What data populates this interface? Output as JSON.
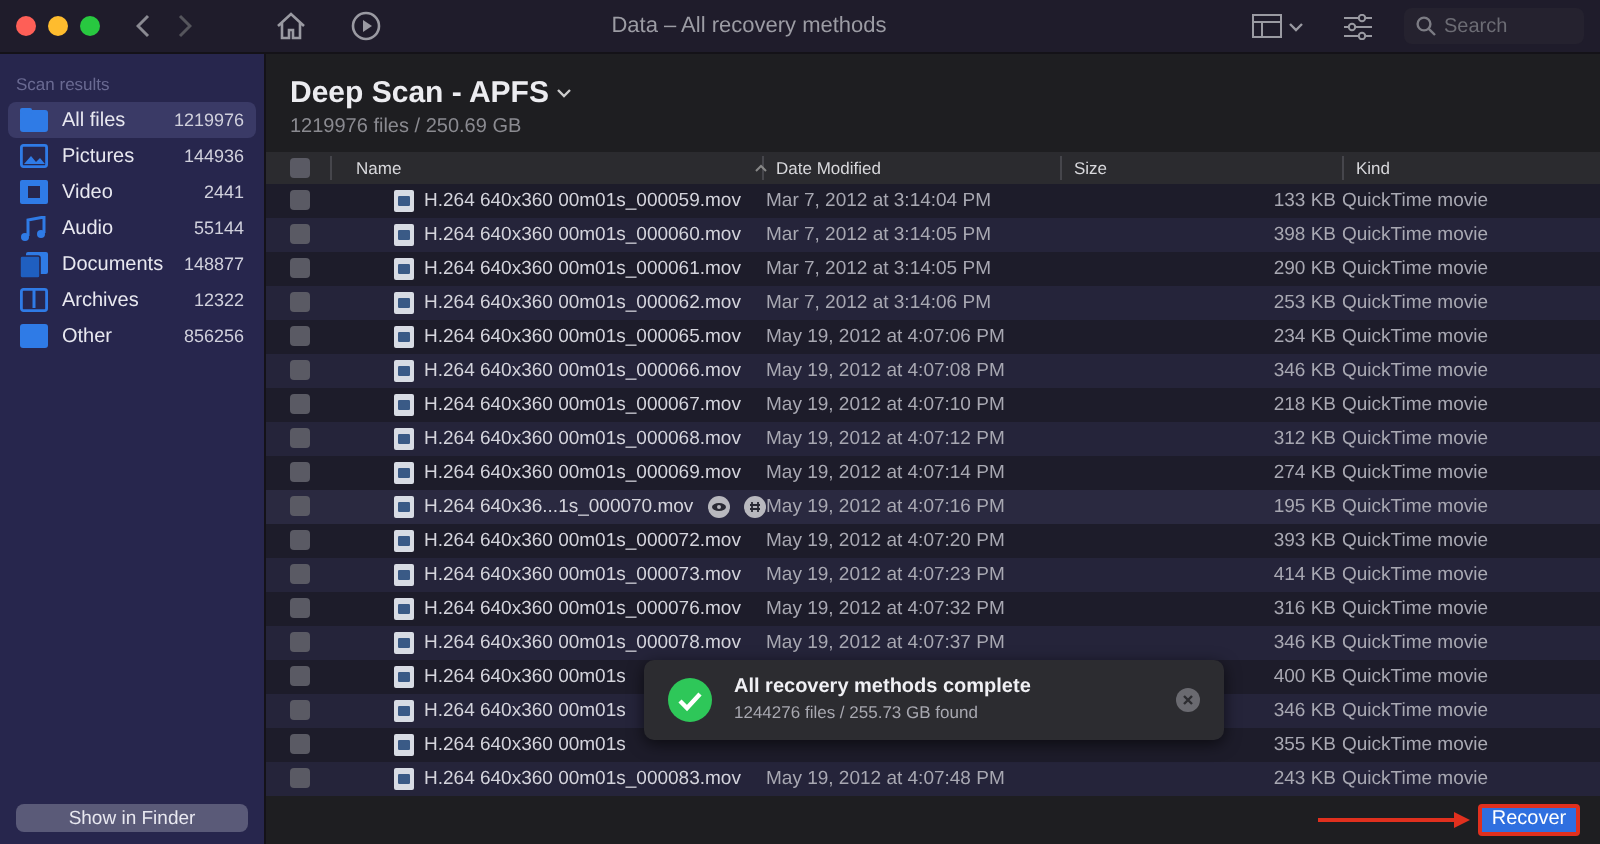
{
  "window": {
    "title": "Data – All recovery methods"
  },
  "toolbar": {
    "search": {
      "placeholder": "Search"
    }
  },
  "sidebar": {
    "heading": "Scan results",
    "items": [
      {
        "label": "All files",
        "count": "1219976",
        "selected": true,
        "kind": "all"
      },
      {
        "label": "Pictures",
        "count": "144936",
        "selected": false,
        "kind": "pictures"
      },
      {
        "label": "Video",
        "count": "2441",
        "selected": false,
        "kind": "video"
      },
      {
        "label": "Audio",
        "count": "55144",
        "selected": false,
        "kind": "audio"
      },
      {
        "label": "Documents",
        "count": "148877",
        "selected": false,
        "kind": "documents"
      },
      {
        "label": "Archives",
        "count": "12322",
        "selected": false,
        "kind": "archives"
      },
      {
        "label": "Other",
        "count": "856256",
        "selected": false,
        "kind": "other"
      }
    ],
    "button": "Show in Finder"
  },
  "header": {
    "title": "Deep Scan - APFS",
    "subtitle": "1219976 files / 250.69 GB"
  },
  "table": {
    "select_all_checked": false,
    "columns": [
      "Name",
      "Date Modified",
      "Size",
      "Kind"
    ],
    "rows": [
      {
        "name": "H.264 640x360 00m01s_000059.mov",
        "date": "Mar 7, 2012 at 3:14:04 PM",
        "size": "133 KB",
        "kind": "QuickTime movie",
        "checked": false,
        "hover": false
      },
      {
        "name": "H.264 640x360 00m01s_000060.mov",
        "date": "Mar 7, 2012 at 3:14:05 PM",
        "size": "398 KB",
        "kind": "QuickTime movie",
        "checked": false,
        "hover": false
      },
      {
        "name": "H.264 640x360 00m01s_000061.mov",
        "date": "Mar 7, 2012 at 3:14:05 PM",
        "size": "290 KB",
        "kind": "QuickTime movie",
        "checked": false,
        "hover": false
      },
      {
        "name": "H.264 640x360 00m01s_000062.mov",
        "date": "Mar 7, 2012 at 3:14:06 PM",
        "size": "253 KB",
        "kind": "QuickTime movie",
        "checked": false,
        "hover": false
      },
      {
        "name": "H.264 640x360 00m01s_000065.mov",
        "date": "May 19, 2012 at 4:07:06 PM",
        "size": "234 KB",
        "kind": "QuickTime movie",
        "checked": false,
        "hover": false
      },
      {
        "name": "H.264 640x360 00m01s_000066.mov",
        "date": "May 19, 2012 at 4:07:08 PM",
        "size": "346 KB",
        "kind": "QuickTime movie",
        "checked": false,
        "hover": false
      },
      {
        "name": "H.264 640x360 00m01s_000067.mov",
        "date": "May 19, 2012 at 4:07:10 PM",
        "size": "218 KB",
        "kind": "QuickTime movie",
        "checked": false,
        "hover": false
      },
      {
        "name": "H.264 640x360 00m01s_000068.mov",
        "date": "May 19, 2012 at 4:07:12 PM",
        "size": "312 KB",
        "kind": "QuickTime movie",
        "checked": false,
        "hover": false
      },
      {
        "name": "H.264 640x360 00m01s_000069.mov",
        "date": "May 19, 2012 at 4:07:14 PM",
        "size": "274 KB",
        "kind": "QuickTime movie",
        "checked": false,
        "hover": false
      },
      {
        "name": "H.264 640x36...1s_000070.mov",
        "date": "May 19, 2012 at 4:07:16 PM",
        "size": "195 KB",
        "kind": "QuickTime movie",
        "checked": false,
        "hover": true
      },
      {
        "name": "H.264 640x360 00m01s_000072.mov",
        "date": "May 19, 2012 at 4:07:20 PM",
        "size": "393 KB",
        "kind": "QuickTime movie",
        "checked": false,
        "hover": false
      },
      {
        "name": "H.264 640x360 00m01s_000073.mov",
        "date": "May 19, 2012 at 4:07:23 PM",
        "size": "414 KB",
        "kind": "QuickTime movie",
        "checked": false,
        "hover": false
      },
      {
        "name": "H.264 640x360 00m01s_000076.mov",
        "date": "May 19, 2012 at 4:07:32 PM",
        "size": "316 KB",
        "kind": "QuickTime movie",
        "checked": false,
        "hover": false
      },
      {
        "name": "H.264 640x360 00m01s_000078.mov",
        "date": "May 19, 2012 at 4:07:37 PM",
        "size": "346 KB",
        "kind": "QuickTime movie",
        "checked": false,
        "hover": false
      },
      {
        "name": "H.264 640x360 00m01s",
        "size": "400 KB",
        "kind": "QuickTime movie",
        "checked": false,
        "hover": false
      },
      {
        "name": "H.264 640x360 00m01s",
        "size": "346 KB",
        "kind": "QuickTime movie",
        "checked": false,
        "hover": false
      },
      {
        "name": "H.264 640x360 00m01s",
        "size": "355 KB",
        "kind": "QuickTime movie",
        "checked": false,
        "hover": false
      },
      {
        "name": "H.264 640x360 00m01s_000083.mov",
        "date": "May 19, 2012 at 4:07:48 PM",
        "size": "243 KB",
        "kind": "QuickTime movie",
        "checked": false,
        "hover": false
      }
    ]
  },
  "toast": {
    "title": "All recovery methods complete",
    "detail": "1244276 files / 255.73 GB found"
  },
  "footer": {
    "button": "Recover"
  }
}
